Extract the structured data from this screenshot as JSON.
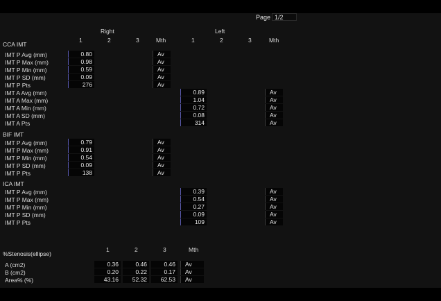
{
  "page": {
    "label": "Page",
    "value": "1/2"
  },
  "headers": {
    "right": "Right",
    "left": "Left",
    "cols": [
      "1",
      "2",
      "3"
    ],
    "mth": "Mth"
  },
  "cca": {
    "title": "CCA IMT",
    "right_rows": [
      {
        "label": "IMT P Avg (mm)",
        "value": "0.80",
        "mth": "Av"
      },
      {
        "label": "IMT P Max (mm)",
        "value": "0.98",
        "mth": "Av"
      },
      {
        "label": "IMT P Min (mm)",
        "value": "0.59",
        "mth": "Av"
      },
      {
        "label": "IMT P SD (mm)",
        "value": "0.09",
        "mth": "Av"
      },
      {
        "label": "IMT P Pts",
        "value": "276",
        "mth": "Av"
      }
    ],
    "left_rows": [
      {
        "label": "IMT A Avg (mm)",
        "value": "0.89",
        "mth": "Av"
      },
      {
        "label": "IMT A Max (mm)",
        "value": "1.04",
        "mth": "Av"
      },
      {
        "label": "IMT A Min (mm)",
        "value": "0.72",
        "mth": "Av"
      },
      {
        "label": "IMT A SD (mm)",
        "value": "0.08",
        "mth": "Av"
      },
      {
        "label": "IMT A Pts",
        "value": "314",
        "mth": "Av"
      }
    ]
  },
  "bif": {
    "title": "BIF IMT",
    "right_rows": [
      {
        "label": "IMT P Avg (mm)",
        "value": "0.79",
        "mth": "Av"
      },
      {
        "label": "IMT P Max (mm)",
        "value": "0.91",
        "mth": "Av"
      },
      {
        "label": "IMT P Min (mm)",
        "value": "0.54",
        "mth": "Av"
      },
      {
        "label": "IMT P SD (mm)",
        "value": "0.09",
        "mth": "Av"
      },
      {
        "label": "IMT P Pts",
        "value": "138",
        "mth": "Av"
      }
    ]
  },
  "ica": {
    "title": "ICA IMT",
    "left_rows": [
      {
        "label": "IMT P Avg (mm)",
        "value": "0.39",
        "mth": "Av"
      },
      {
        "label": "IMT P Max (mm)",
        "value": "0.54",
        "mth": "Av"
      },
      {
        "label": "IMT P Min (mm)",
        "value": "0.27",
        "mth": "Av"
      },
      {
        "label": "IMT P SD (mm)",
        "value": "0.09",
        "mth": "Av"
      },
      {
        "label": "IMT P Pts",
        "value": "109",
        "mth": "Av"
      }
    ]
  },
  "stenosis": {
    "title": "%Stenosis(ellipse)",
    "cols": [
      "1",
      "2",
      "3"
    ],
    "mth": "Mth",
    "rows": [
      {
        "label": "A (cm2)",
        "v1": "0.36",
        "v2": "0.46",
        "v3": "0.46",
        "mth": "Av"
      },
      {
        "label": "B (cm2)",
        "v1": "0.20",
        "v2": "0.22",
        "v3": "0.17",
        "mth": "Av"
      },
      {
        "label": "Area% (%)",
        "v1": "43.16",
        "v2": "52.32",
        "v3": "62.53",
        "mth": "Av"
      }
    ]
  },
  "colors": {
    "value_border": "#5a5ab0",
    "background": "#121212"
  }
}
